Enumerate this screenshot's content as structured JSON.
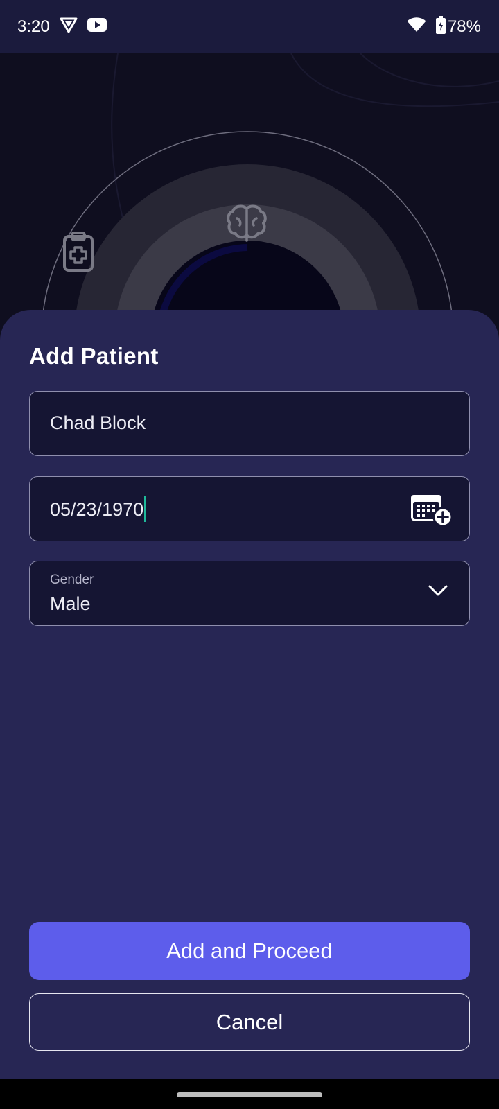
{
  "status_bar": {
    "time": "3:20",
    "battery": "78%",
    "icons": [
      "shield-app-icon",
      "youtube-icon",
      "wifi-icon",
      "battery-charging-icon"
    ]
  },
  "background": {
    "icons": [
      "clipboard-medical-icon",
      "brain-icon"
    ]
  },
  "sheet": {
    "title": "Add Patient",
    "name_field": {
      "value": "Chad Block"
    },
    "dob_field": {
      "value": "05/23/1970",
      "icon": "calendar-add-icon"
    },
    "gender_field": {
      "label": "Gender",
      "value": "Male",
      "icon": "chevron-down-icon"
    },
    "primary_button": "Add and Proceed",
    "secondary_button": "Cancel"
  },
  "colors": {
    "sheet_bg": "#272654",
    "field_bg": "#151533",
    "primary": "#5d5deb",
    "cursor": "#1fb89a"
  }
}
